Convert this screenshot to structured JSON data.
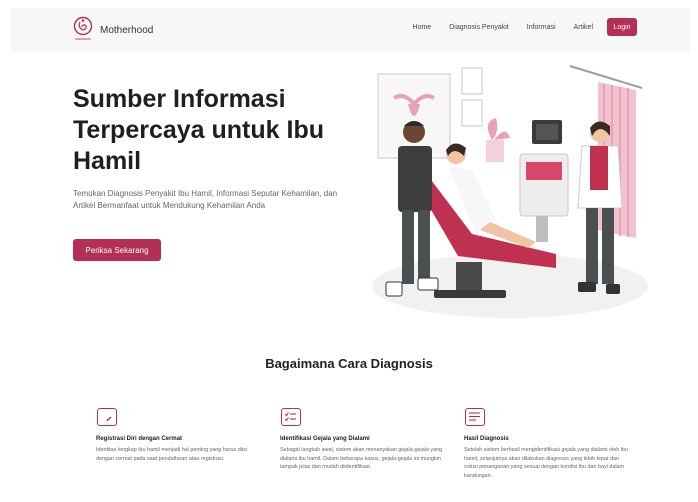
{
  "brand": {
    "name": "Motherhood"
  },
  "nav": {
    "items": [
      "Home",
      "Diagnosis Penyakit",
      "Informasi",
      "Artikel"
    ],
    "login_label": "Login"
  },
  "hero": {
    "title": "Sumber Informasi Terpercaya untuk Ibu Hamil",
    "description": "Temukan Diagnosis Penyakit Ibu Hamil, Informasi Seputar Kehamilan, dan Artikel Bermanfaat untuk Mendukung Kehamilan Anda",
    "cta_label": "Periksa Sekarang"
  },
  "how": {
    "title": "Bagaimana Cara Diagnosis",
    "steps": [
      {
        "icon": "edit-icon",
        "title": "Registrasi Diri dengan Cermat",
        "desc": "Identitas lengkap ibu hamil menjadi hal penting yang harus diisi dengan cermat pada saat pendaftaran atau registrasi."
      },
      {
        "icon": "checklist-icon",
        "title": "Identifikasi Gejala yang Dialami",
        "desc": "Sebagai langkah awal, sistem akan menanyakan gejala-gejala yang dialami ibu hamil. Dalam beberapa kasus, gejala-gejala ini mungkin tampak jelas dan mudah diidentifikasi."
      },
      {
        "icon": "document-icon",
        "title": "Hasil Diagnosis",
        "desc": "Setelah sistem berhasil mengidentifikasi gejala yang dialami oleh ibu hamil, selanjutnya akan dilakukan diagnosis yang lebih tepat dan solusi penanganan yang sesuai dengan kondisi ibu dan bayi dalam kandungan."
      }
    ]
  },
  "colors": {
    "accent": "#b42f55",
    "navbar_bg": "#f7f7f8"
  }
}
